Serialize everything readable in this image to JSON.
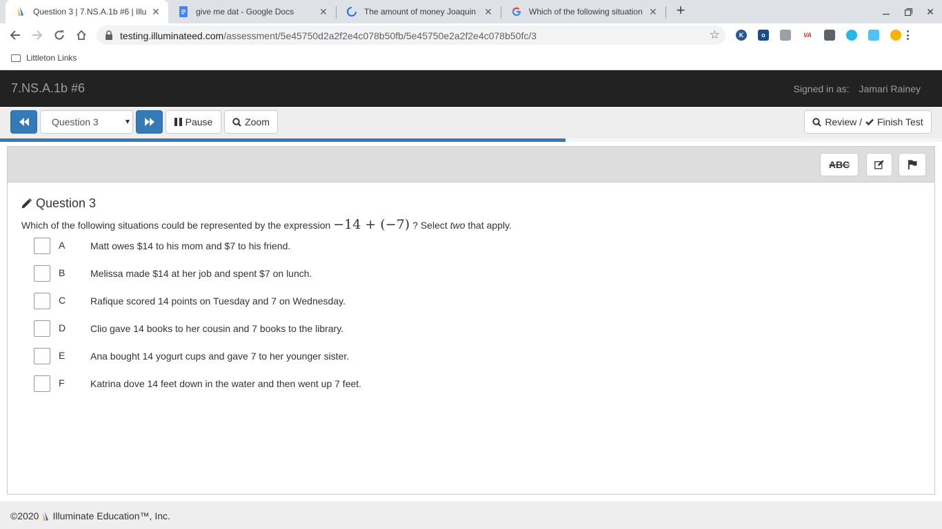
{
  "browser": {
    "tabs": [
      {
        "title": "Question 3 | 7.NS.A.1b #6 | Illum",
        "favicon": "illuminate-icon",
        "active": true
      },
      {
        "title": "give me dat - Google Docs",
        "favicon": "google-docs-icon",
        "active": false
      },
      {
        "title": "The amount of money Joaquin t",
        "favicon": "loading-spinner-icon",
        "active": false
      },
      {
        "title": "Which of the following situation",
        "favicon": "google-icon",
        "active": false
      }
    ],
    "url_host": "testing.illuminateed.com",
    "url_path": "/assessment/5e45750d2a2f2e4c078b50fb/5e45750e2a2f2e4c078b50fc/3",
    "bookmark_folder": "Littleton Links",
    "extensions": [
      {
        "name": "k-extension-icon",
        "glyph": "K",
        "color": "#2b5797"
      },
      {
        "name": "o-extension-icon",
        "glyph": "o",
        "color": "#1a4e8a"
      },
      {
        "name": "copy-extension-icon",
        "glyph": "",
        "color": "#9aa0a6"
      },
      {
        "name": "va-extension-icon",
        "glyph": "VA",
        "color": "#d93025"
      },
      {
        "name": "location-extension-icon",
        "glyph": "",
        "color": "#5f6368"
      },
      {
        "name": "cyan-extension-icon",
        "glyph": "",
        "color": "#28b6e6"
      },
      {
        "name": "profile-extension-icon",
        "glyph": "",
        "color": "#4fc3f7"
      },
      {
        "name": "orange-extension-icon",
        "glyph": "",
        "color": "#f5b400"
      }
    ]
  },
  "app": {
    "title": "7.NS.A.1b #6",
    "signed_in_label": "Signed in as:",
    "user_name": "Jamari Rainey"
  },
  "nav": {
    "question_select": "Question 3",
    "pause_label": "Pause",
    "zoom_label": "Zoom",
    "review_label": "Review /",
    "finish_label": "Finish Test",
    "progress_fraction": 0.6
  },
  "tools": {
    "abc_label": "ABC"
  },
  "question": {
    "heading": "Question 3",
    "prompt_before": "Which of the following situations could be represented by the expression",
    "expression": "−14 + (−7)",
    "prompt_after_1": "? Select",
    "prompt_emphasis": "two",
    "prompt_after_2": "that apply.",
    "choices": [
      {
        "letter": "A",
        "text": "Matt owes $14 to his mom and $7 to his friend."
      },
      {
        "letter": "B",
        "text": "Melissa made $14 at her job and spent $7 on lunch."
      },
      {
        "letter": "C",
        "text": "Rafique scored 14 points on Tuesday and 7 on Wednesday."
      },
      {
        "letter": "D",
        "text": "Clio gave 14 books to her cousin and 7 books to the library."
      },
      {
        "letter": "E",
        "text": "Ana bought 14 yogurt cups and gave 7 to her younger sister."
      },
      {
        "letter": "F",
        "text": "Katrina dove 14 feet down in the water and then went up 7 feet."
      }
    ]
  },
  "footer": {
    "copyright": "©2020",
    "company": "Illuminate Education™, Inc."
  },
  "colors": {
    "primary": "#337ab7",
    "header_bg": "#222222",
    "nav_bg": "#eeeeee"
  }
}
